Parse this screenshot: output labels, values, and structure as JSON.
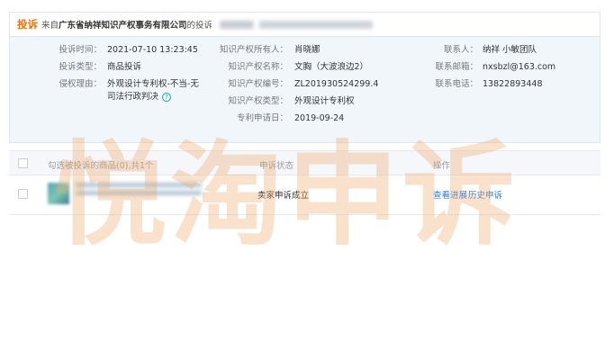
{
  "header": {
    "tag": "投诉",
    "from_prefix": "来自",
    "company": "广东省纳祥知识产权事务有限公司",
    "suffix": "的投诉"
  },
  "details": {
    "col1": [
      {
        "label": "投诉时间：",
        "value": "2021-07-10 13:23:45"
      },
      {
        "label": "投诉类型：",
        "value": "商品投诉"
      },
      {
        "label": "侵权理由：",
        "value_line1": "外观设计专利权-不当-无",
        "value_line2": "司法行政判决"
      }
    ],
    "col2": [
      {
        "label": "知识产权所有人：",
        "value": "肖晓娜"
      },
      {
        "label": "知识产权名称：",
        "value": "文胸（大波浪边2）"
      },
      {
        "label": "知识产权编号：",
        "value": "ZL201930524299.4"
      },
      {
        "label": "知识产权类型：",
        "value": "外观设计专利权"
      },
      {
        "label": "专利申请日：",
        "value": "2019-09-24"
      }
    ],
    "col3": [
      {
        "label": "联系人：",
        "value": "纳祥 小敏团队"
      },
      {
        "label": "联系邮箱：",
        "value": "nxsbzl@163.com"
      },
      {
        "label": "联系电话：",
        "value": "13822893448"
      }
    ]
  },
  "table": {
    "headers": {
      "goods": "勾选被投诉的商品(0),共1个",
      "status": "申诉状态",
      "action": "操作"
    },
    "rows": [
      {
        "status": "卖家申诉成立",
        "view_progress": "查看进展",
        "history": "历史申诉"
      }
    ]
  },
  "watermark": "悦淘申诉",
  "colors": {
    "accent": "#ff6a00",
    "link": "#2a7ae2",
    "panel_bg": "#f1f6fb"
  }
}
